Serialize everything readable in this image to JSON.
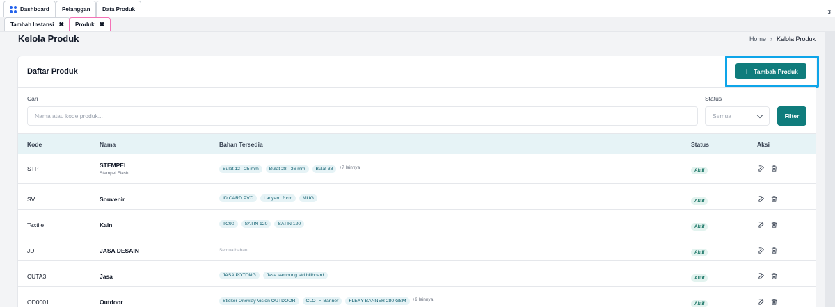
{
  "tabs_top": [
    {
      "label": "Dashboard",
      "icon": "grid-icon"
    },
    {
      "label": "Pelanggan"
    },
    {
      "label": "Data Produk"
    }
  ],
  "tabs_open": [
    {
      "label": "Tambah Instansi",
      "close": "✖"
    },
    {
      "label": "Produk",
      "close": "✖",
      "active": true
    }
  ],
  "edge_number": "3",
  "header": {
    "title": "Kelola Produk",
    "breadcrumb": [
      "Home",
      "Kelola Produk"
    ]
  },
  "card": {
    "title": "Daftar Produk",
    "add_button": "Tambah Produk",
    "search_label": "Cari",
    "search_placeholder": "Nama atau kode produk...",
    "status_label": "Status",
    "status_selected": "Semua",
    "filter_button": "Filter"
  },
  "table": {
    "columns": [
      "Kode",
      "Nama",
      "Bahan Tersedia",
      "Status",
      "Aksi"
    ],
    "rows": [
      {
        "kode": "STP",
        "nama": "STEMPEL",
        "sub": "Stempel Flash",
        "chips": [
          "Bulat 12 - 25 mm",
          "Bulat 28 - 36 mm",
          "Bulat 38"
        ],
        "more": "+7 lainnya",
        "status": "Aktif"
      },
      {
        "kode": "SV",
        "nama": "Souvenir",
        "chips": [
          "ID CARD PVC",
          "Lanyard 2 cm",
          "MUG"
        ],
        "status": "Aktif"
      },
      {
        "kode": "Textile",
        "nama": "Kain",
        "chips": [
          "TC90",
          "SATIN 120",
          "SATIN 120"
        ],
        "status": "Aktif"
      },
      {
        "kode": "JD",
        "nama": "JASA DESAIN",
        "none": "Semua bahan",
        "status": "Aktif"
      },
      {
        "kode": "CUTA3",
        "nama": "Jasa",
        "chips": [
          "JASA POTONG",
          "Jasa sambung std billboard"
        ],
        "status": "Aktif"
      },
      {
        "kode": "OD0001",
        "nama": "Outdoor",
        "chips": [
          "Sticker Oneway Vision OUTDOOR",
          "CLOTH Banner",
          "FLEXY BANNER 280 GSM"
        ],
        "more": "+9 lainnya",
        "status": "Aktif"
      }
    ]
  },
  "colors": {
    "accent": "#0f7c7c",
    "highlight": "#0ea5e9"
  }
}
